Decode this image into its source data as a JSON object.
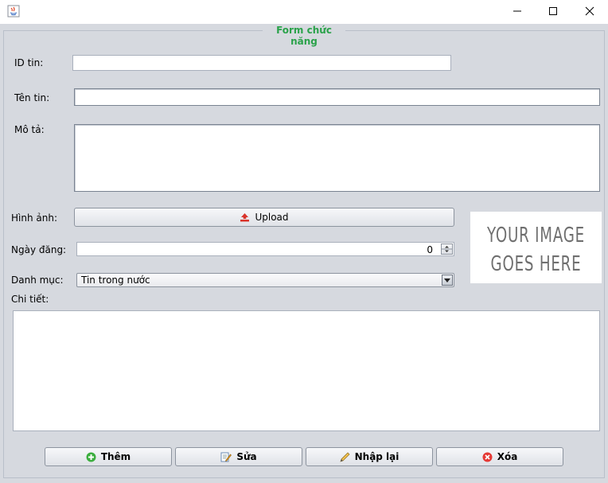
{
  "window": {
    "title": "",
    "controls": {
      "minimize": "minimize-icon",
      "maximize": "maximize-icon",
      "close": "close-icon"
    }
  },
  "form": {
    "legend": "Form chức năng",
    "id_label": "ID tin:",
    "id_value": "",
    "name_label": "Tên tin:",
    "name_value": "",
    "desc_label": "Mô tả:",
    "desc_value": "",
    "image_label": "Hình ảnh:",
    "upload_label": "Upload",
    "date_label": "Ngày đăng:",
    "date_value": "0",
    "category_label": "Danh mục:",
    "category_value": "Tin trong nước",
    "detail_label": "Chi tiết:",
    "detail_value": "",
    "image_placeholder_line1": "YOUR IMAGE",
    "image_placeholder_line2": "GOES HERE"
  },
  "buttons": {
    "add": "Thêm",
    "edit": "Sửa",
    "reset": "Nhập lại",
    "delete": "Xóa"
  },
  "colors": {
    "legend": "#2aa24a",
    "background": "#d6d9df",
    "add_icon": "#3cae3f",
    "delete_icon": "#e53935",
    "upload_icon": "#d9342b"
  }
}
